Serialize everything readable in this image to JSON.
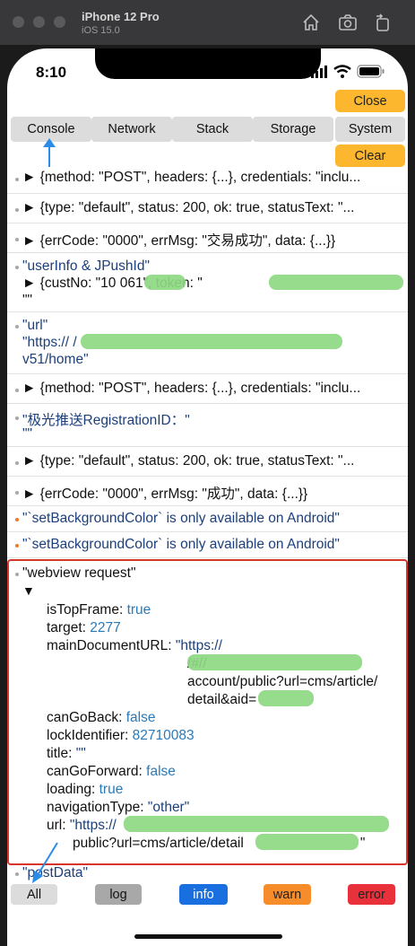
{
  "simulator": {
    "device": "iPhone 12 Pro",
    "os": "iOS 15.0"
  },
  "status_bar": {
    "time": "8:10"
  },
  "tabs": [
    "Console",
    "Network",
    "Stack",
    "Storage",
    "System"
  ],
  "actions": {
    "close": "Close",
    "clear": "Clear"
  },
  "logs": [
    {
      "marker": "►",
      "text": "{method: \"POST\", headers: {...}, credentials: \"inclu...",
      "level": "log"
    },
    {
      "marker": "►",
      "text": "{type: \"default\", status: 200, ok: true, statusText: \"...",
      "level": "log"
    },
    {
      "marker": "►",
      "text": "{errCode: \"0000\", errMsg: \"交易成功\", data: {...}}",
      "level": "log"
    },
    {
      "line1": "\"userInfo & JPushId\"",
      "line2": "► {custNo: \"10      061\", token: \"",
      "line3": "\"\"",
      "level": "log"
    },
    {
      "line1": "\"url\"",
      "line2": "\"https://                          /",
      "line3": "v51/home\"",
      "level": "log"
    },
    {
      "marker": "►",
      "text": "{method: \"POST\", headers: {...}, credentials: \"inclu...",
      "level": "log"
    },
    {
      "line1": "\"极光推送RegistrationID：\"",
      "line2": "\"\"",
      "level": "log"
    },
    {
      "marker": "►",
      "text": "{type: \"default\", status: 200, ok: true, statusText: \"...",
      "level": "log"
    },
    {
      "marker": "►",
      "text": "{errCode: \"0000\", errMsg: \"成功\", data: {...}}",
      "level": "log"
    },
    {
      "text": "\"`setBackgroundColor` is only available on Android\"",
      "level": "warn"
    },
    {
      "text": "\"`setBackgroundColor` is only available on Android\"",
      "level": "warn"
    }
  ],
  "webview": {
    "title": "\"webview request\"",
    "marker": "▼",
    "props": {
      "isTopFrame": "true",
      "target": "2277",
      "mainDocumentURL_1": "\"https://",
      "mainDocumentURL_2": "/#//",
      "mainDocumentURL_3": "account/public?url=cms/article/",
      "mainDocumentURL_4": "detail&aid=",
      "canGoBack": "false",
      "lockIdentifier": "82710083",
      "title": "\"\"",
      "canGoForward": "false",
      "loading": "true",
      "navigationType": "\"other\"",
      "url_1": "\"https://",
      "url_2": "public?url=cms/article/detail",
      "url_3": "\""
    },
    "keys": {
      "isTopFrame": "isTopFrame: ",
      "target": "target: ",
      "mainDocumentURL": "mainDocumentURL: ",
      "canGoBack": "canGoBack: ",
      "lockIdentifier": "lockIdentifier: ",
      "title": "title: ",
      "canGoForward": "canGoForward: ",
      "loading": "loading: ",
      "navigationType": "navigationType: ",
      "url": "url: "
    }
  },
  "partial_log": "\"postData\"",
  "filters": [
    {
      "label": "All",
      "bg": "#dcdcdc",
      "fg": "#111111"
    },
    {
      "label": "log",
      "bg": "#a8a8a8",
      "fg": "#111111"
    },
    {
      "label": "info",
      "bg": "#1a6fe0",
      "fg": "#ffffff"
    },
    {
      "label": "warn",
      "bg": "#f78c2a",
      "fg": "#222222"
    },
    {
      "label": "error",
      "bg": "#e8313a",
      "fg": "#222222"
    }
  ],
  "colors": {
    "accent": "#fdb72f",
    "highlight_border": "#d9342b",
    "arrow": "#2b8be8",
    "redaction": "#8dd982"
  }
}
